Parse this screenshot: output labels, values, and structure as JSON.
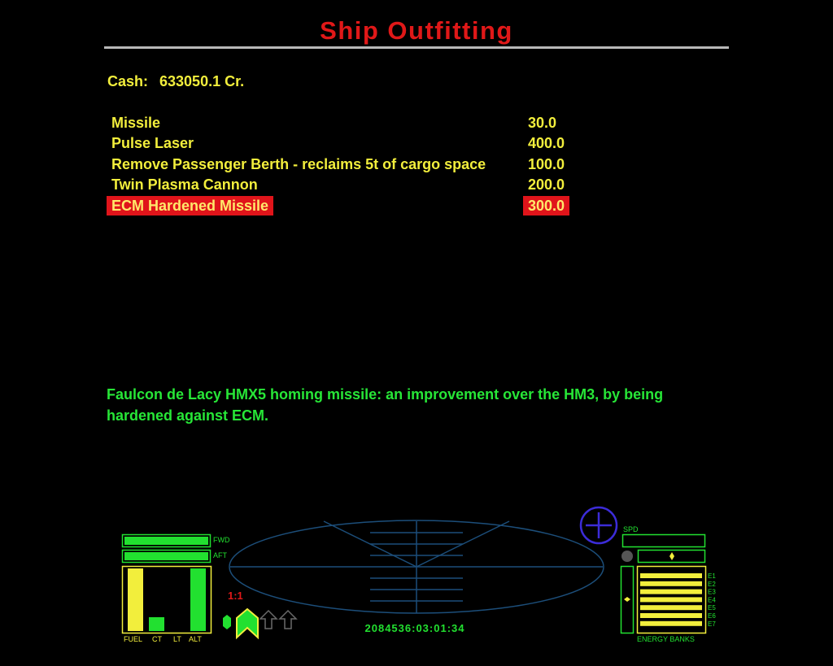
{
  "screen": {
    "title": "Ship Outfitting"
  },
  "cash": {
    "label": "Cash:",
    "value": "633050.1 Cr."
  },
  "equipment": [
    {
      "name": "Missile",
      "price": "30.0",
      "selected": false
    },
    {
      "name": "Pulse Laser",
      "price": "400.0",
      "selected": false
    },
    {
      "name": "Remove Passenger Berth - reclaims 5t of cargo space",
      "price": "100.0",
      "selected": false
    },
    {
      "name": "Twin Plasma Cannon",
      "price": "200.0",
      "selected": false
    },
    {
      "name": "ECM Hardened Missile",
      "price": "300.0",
      "selected": true
    }
  ],
  "description": "Faulcon de Lacy HMX5 homing missile: an improvement over the HM3, by being hardened against ECM.",
  "hud": {
    "shield_labels": {
      "forward": "FWD",
      "aft": "AFT"
    },
    "gauges": [
      {
        "label": "FUEL",
        "level": 1.0,
        "color": "#f2ee3c"
      },
      {
        "label": "CT",
        "level": 0.22,
        "color": "#22e030"
      },
      {
        "label": "LT",
        "level": 0.0,
        "color": "#22e030"
      },
      {
        "label": "ALT",
        "level": 1.0,
        "color": "#22e030"
      }
    ],
    "time_acceleration": "1:1",
    "clock": "2084536:03:01:34",
    "speed_label": "SPD",
    "energy_banks_label": "ENERGY BANKS",
    "energy_banks": [
      {
        "label": "E1",
        "level": 1.0
      },
      {
        "label": "E2",
        "level": 1.0
      },
      {
        "label": "E3",
        "level": 1.0
      },
      {
        "label": "E4",
        "level": 1.0
      },
      {
        "label": "E5",
        "level": 1.0
      },
      {
        "label": "E6",
        "level": 1.0
      },
      {
        "label": "E7",
        "level": 1.0
      }
    ],
    "colors": {
      "green": "#22e030",
      "yellow": "#f2ee3c",
      "red": "#e01818",
      "scanner": "#1c4e7a",
      "compass": "#3c2cd8"
    },
    "icons": [
      "compass-icon",
      "missile-icon",
      "player-ship-icon",
      "ship-outline-icon"
    ]
  }
}
